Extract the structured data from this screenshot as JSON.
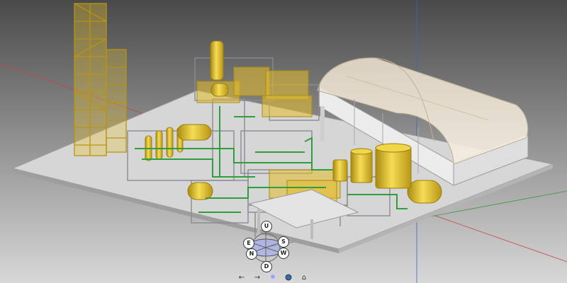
{
  "gizmo": {
    "up": "U",
    "down": "D",
    "north": "N",
    "south": "S",
    "east": "E",
    "west": "W"
  },
  "navbar": {
    "back": "←",
    "forward": "→",
    "home": "⌂"
  },
  "colors": {
    "axis_red": "#d04040",
    "axis_blue": "#4060d0",
    "axis_green": "#3a9a3a",
    "equipment_yellow": "#e8c12a",
    "steel_grey": "#9a9aa2",
    "pipe_green": "#2e9e3e"
  }
}
